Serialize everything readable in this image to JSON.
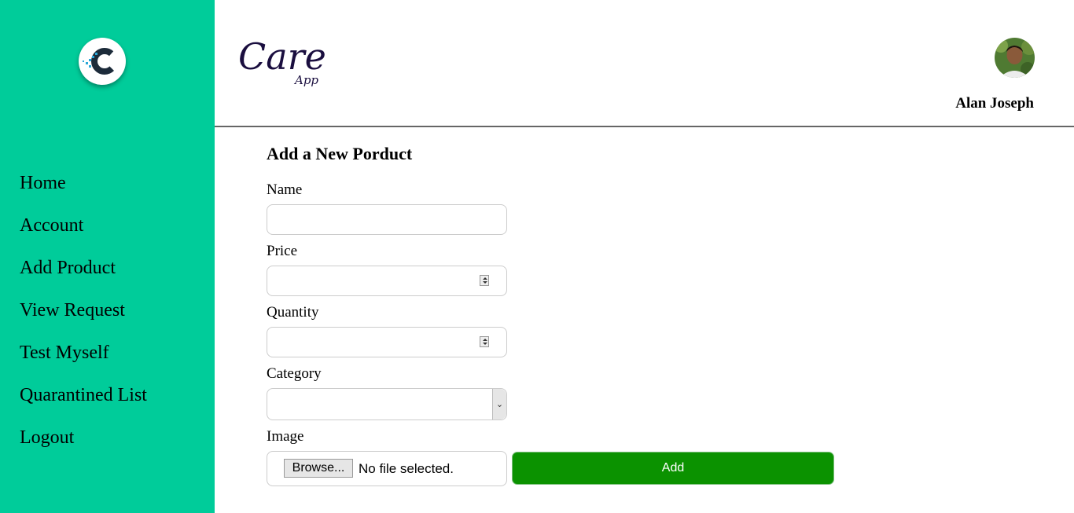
{
  "brand": {
    "name": "Care",
    "sub": "App"
  },
  "sidebar": {
    "items": [
      {
        "label": "Home"
      },
      {
        "label": "Account"
      },
      {
        "label": "Add Product"
      },
      {
        "label": "View Request"
      },
      {
        "label": "Test Myself"
      },
      {
        "label": "Quarantined List"
      },
      {
        "label": "Logout"
      }
    ]
  },
  "header": {
    "user_name": "Alan Joseph"
  },
  "form": {
    "title": "Add a New Porduct",
    "name_label": "Name",
    "name_value": "",
    "price_label": "Price",
    "price_value": "",
    "quantity_label": "Quantity",
    "quantity_value": "",
    "category_label": "Category",
    "category_selected": "",
    "image_label": "Image",
    "browse_label": "Browse...",
    "file_status": "No file selected.",
    "add_label": "Add"
  },
  "colors": {
    "sidebar_bg": "#00cc9a",
    "add_button": "#0b9200",
    "brand_text": "#1a0e3f"
  },
  "icons": {
    "logo": "c-pixel-logo-icon",
    "avatar": "user-avatar-photo",
    "spinner": "number-spinner-icon",
    "select": "chevron-down-icon"
  }
}
